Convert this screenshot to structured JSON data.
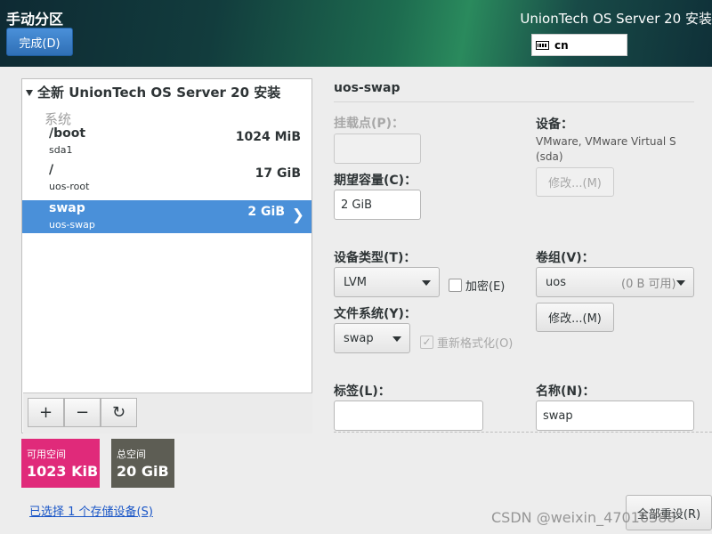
{
  "header": {
    "title": "手动分区",
    "done_label": "完成(D)",
    "product": "UnionTech OS Server 20 安装",
    "keyboard_layout": "cn"
  },
  "tree": {
    "install_title": "全新 UnionTech OS Server 20 安装",
    "group_label": "系统",
    "items": [
      {
        "name": "/boot",
        "device": "sda1",
        "size": "1024 MiB"
      },
      {
        "name": "/",
        "device": "uos-root",
        "size": "17 GiB"
      },
      {
        "name": "swap",
        "device": "uos-swap",
        "size": "2 GiB"
      }
    ],
    "selected_index": 2
  },
  "toolbar": {
    "add_icon": "plus-icon",
    "remove_icon": "minus-icon",
    "refresh_icon": "refresh-icon"
  },
  "space": {
    "available_label": "可用空间",
    "available_value": "1023 KiB",
    "total_label": "总空间",
    "total_value": "20 GiB",
    "available_color": "#e02a7a",
    "total_color": "#5d5d54"
  },
  "storage_link": "已选择 1 个存储设备(S)",
  "detail": {
    "title": "uos-swap",
    "mount_point_label": "挂载点(P)：",
    "mount_point_value": "",
    "capacity_label": "期望容量(C)：",
    "capacity_value": "2 GiB",
    "device_label": "设备：",
    "device_text": "VMware, VMware Virtual S (sda)",
    "device_modify_label": "修改...(M)",
    "device_type_label": "设备类型(T)：",
    "device_type_value": "LVM",
    "encrypt_label": "加密(E)",
    "volume_group_label": "卷组(V)：",
    "volume_group_value": "uos",
    "volume_group_free": "(0 B 可用)",
    "volume_modify_label": "修改...(M)",
    "filesystem_label": "文件系统(Y)：",
    "filesystem_value": "swap",
    "reformat_label": "重新格式化(O)",
    "label_label": "标签(L)：",
    "label_value": "",
    "name_label": "名称(N)：",
    "name_value": "swap"
  },
  "reset_label": "全部重设(R)",
  "watermark": "CSDN @weixin_47016388",
  "accent_color": "#4a90d9"
}
